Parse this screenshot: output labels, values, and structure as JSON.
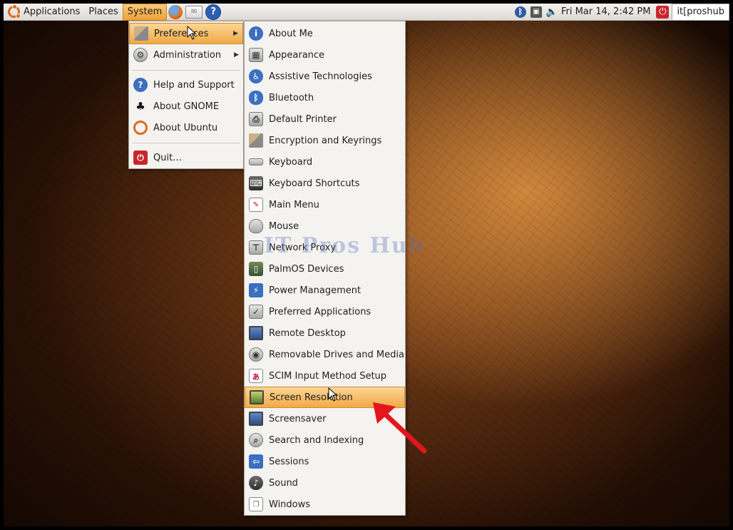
{
  "top_panel": {
    "applications": "Applications",
    "places": "Places",
    "system": "System",
    "clock": "Fri Mar 14,  2:42 PM",
    "user": "it[proshub"
  },
  "system_menu": {
    "items": [
      {
        "label": "Preferences",
        "icon": "preferences-icon",
        "has_submenu": true
      },
      {
        "label": "Administration",
        "icon": "gear-icon",
        "has_submenu": true
      },
      {
        "label": "Help and Support",
        "icon": "help-icon"
      },
      {
        "label": "About GNOME",
        "icon": "gnome-foot-icon"
      },
      {
        "label": "About Ubuntu",
        "icon": "ubuntu-icon"
      },
      {
        "label": "Quit...",
        "icon": "quit-icon"
      }
    ]
  },
  "preferences_menu": {
    "items": [
      {
        "label": "About Me"
      },
      {
        "label": "Appearance"
      },
      {
        "label": "Assistive Technologies"
      },
      {
        "label": "Bluetooth"
      },
      {
        "label": "Default Printer"
      },
      {
        "label": "Encryption and Keyrings"
      },
      {
        "label": "Keyboard"
      },
      {
        "label": "Keyboard Shortcuts"
      },
      {
        "label": "Main Menu"
      },
      {
        "label": "Mouse"
      },
      {
        "label": "Network Proxy"
      },
      {
        "label": "PalmOS Devices"
      },
      {
        "label": "Power Management"
      },
      {
        "label": "Preferred Applications"
      },
      {
        "label": "Remote Desktop"
      },
      {
        "label": "Removable Drives and Media"
      },
      {
        "label": "SCIM Input Method Setup"
      },
      {
        "label": "Screen Resolution"
      },
      {
        "label": "Screensaver"
      },
      {
        "label": "Search and Indexing"
      },
      {
        "label": "Sessions"
      },
      {
        "label": "Sound"
      },
      {
        "label": "Windows"
      }
    ],
    "highlighted": "Screen Resolution"
  },
  "watermark": "IT Pros Hub",
  "colors": {
    "highlight": "#f1a948",
    "arrow": "#e3161c"
  }
}
